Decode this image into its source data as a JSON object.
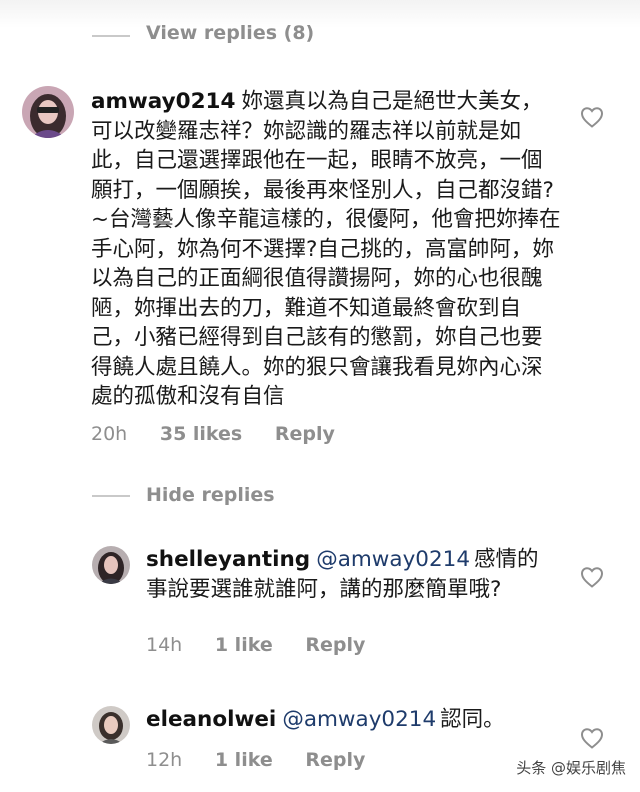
{
  "thread_top": {
    "label": "View replies (8)"
  },
  "main_comment": {
    "username": "amway0214",
    "text": "妳還真以為自己是絕世大美女，可以改變羅志祥？妳認識的羅志祥以前就是如此，自己還選擇跟他在一起，眼睛不放亮，一個願打，一個願挨，最後再來怪別人，自己都沒錯?~台灣藝人像辛龍這樣的，很優阿，他會把妳捧在手心阿，妳為何不選擇?自己挑的，高富帥阿，妳以為自己的正面綱很值得讚揚阿，妳的心也很醜陋，妳揮出去的刀，難道不知道最終會砍到自己，小豬已經得到自己該有的懲罰，妳自己也要得饒人處且饒人。妳的狠只會讓我看見妳內心深處的孤傲和沒有自信",
    "time": "20h",
    "likes": "35 likes",
    "reply": "Reply"
  },
  "hide_replies": {
    "label": "Hide replies"
  },
  "replies": [
    {
      "username": "shelleyanting",
      "mention": "@amway0214",
      "text": "感情的事說要選誰就誰阿，講的那麼簡單哦?",
      "time": "14h",
      "likes": "1 like",
      "reply": "Reply"
    },
    {
      "username": "eleanolwei",
      "mention": "@amway0214",
      "text": "認同。",
      "time": "12h",
      "likes": "1 like",
      "reply": "Reply"
    }
  ],
  "watermark": "头条 @娱乐剧焦",
  "icons": {
    "like": "heart-outline-icon"
  }
}
